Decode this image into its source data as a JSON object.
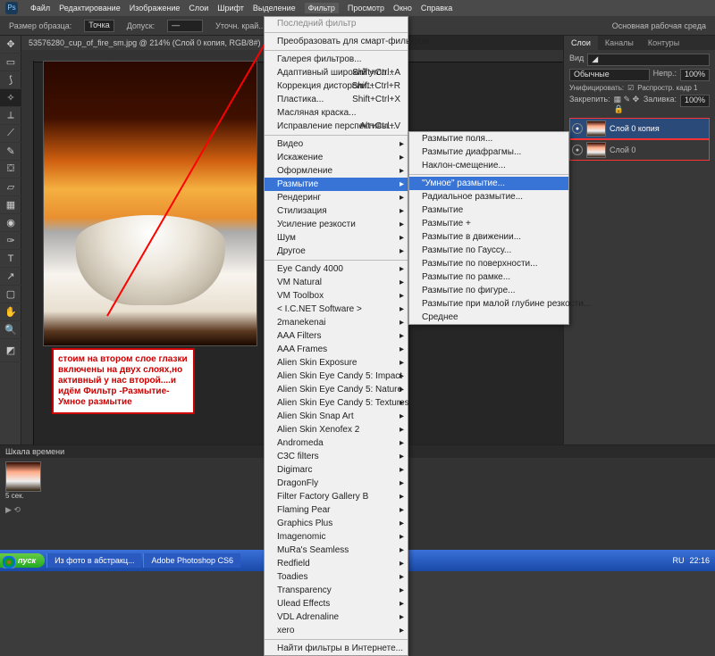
{
  "menubar": [
    "Файл",
    "Редактирование",
    "Изображение",
    "Слои",
    "Шрифт",
    "Выделение",
    "Фильтр",
    "Просмотр",
    "Окно",
    "Справка"
  ],
  "optbar": {
    "label1": "Размер образца:",
    "v1": "Точка",
    "label2": "Допуск:",
    "v2": "—",
    "workspace": "Основная рабочая среда",
    "other": "Уточн. край..."
  },
  "doc_tab": "53576280_cup_of_fire_sm.jpg @ 214% (Слой 0 копия, RGB/8#)",
  "zoom": "214.36%",
  "annotation": "стоим на втором слое глазки включены на двух слоях,но активный у нас второй....и идём Фильтр -Размытие-Умное размытие",
  "filter_menu": {
    "top": [
      {
        "t": "Последний фильтр",
        "d": true
      }
    ],
    "g1": [
      "Преобразовать для смарт-фильтров"
    ],
    "g2": [
      {
        "t": "Галерея фильтров..."
      },
      {
        "t": "Адаптивный широкий угол...",
        "sc": "Shift+Ctrl+A"
      },
      {
        "t": "Коррекция дисторсии...",
        "sc": "Shift+Ctrl+R"
      },
      {
        "t": "Пластика...",
        "sc": "Shift+Ctrl+X"
      },
      {
        "t": "Масляная краска..."
      },
      {
        "t": "Исправление перспективы...",
        "sc": "Alt+Ctrl+V"
      }
    ],
    "g3": [
      "Видео",
      "Искажение",
      "Оформление",
      "Размытие",
      "Рендеринг",
      "Стилизация",
      "Усиление резкости",
      "Шум",
      "Другое"
    ],
    "g4": [
      "Eye Candy 4000",
      "VM Natural",
      "VM Toolbox",
      "< I.C.NET Software >",
      "2manekenai",
      "AAA Filters",
      "AAA Frames",
      "Alien Skin Exposure",
      "Alien Skin Eye Candy 5: Impact",
      "Alien Skin Eye Candy 5: Nature",
      "Alien Skin Eye Candy 5: Textures",
      "Alien Skin Snap Art",
      "Alien Skin Xenofex 2",
      "Andromeda",
      "C3C filters",
      "Digimarc",
      "DragonFly",
      "Filter Factory Gallery B",
      "Flaming Pear",
      "Graphics Plus",
      "Imagenomic",
      "MuRa's Seamless",
      "Redfield",
      "Toadies",
      "Transparency",
      "Ulead Effects",
      "VDL Adrenaline",
      "xero"
    ],
    "last": "Найти фильтры в Интернете..."
  },
  "blur_menu": [
    "Размытие поля...",
    "Размытие диафрагмы...",
    "Наклон-смещение...",
    "\"Умное\" размытие...",
    "Радиальное размытие...",
    "Размытие",
    "Размытие +",
    "Размытие в движении...",
    "Размытие по Гауссу...",
    "Размытие по поверхности...",
    "Размытие по рамке...",
    "Размытие по фигуре...",
    "Размытие при малой глубине резкости...",
    "Среднее"
  ],
  "panels": {
    "tabs_top": [
      "Слои",
      "Каналы",
      "Контуры"
    ],
    "kind": "Вид",
    "blend": "Обычные",
    "opacity_lbl": "Непр.:",
    "opacity": "100%",
    "unify": "Унифицировать:",
    "spread": "Распростр. кадр 1",
    "lock": "Закрепить:",
    "fill_lbl": "Заливка:",
    "fill": "100%",
    "layers": [
      {
        "name": "Слой 0 копия",
        "active": true
      },
      {
        "name": "Слой 0",
        "active": false
      }
    ]
  },
  "timeline": {
    "title": "Шкала времени",
    "frame": "5 сек.",
    "toolbar": "▶ ⟲"
  },
  "taskbar": {
    "start": "пуск",
    "btns": [
      "Из фото в абстракц...",
      "Adobe Photoshop CS6"
    ],
    "lang": "RU",
    "time": "22:16"
  }
}
